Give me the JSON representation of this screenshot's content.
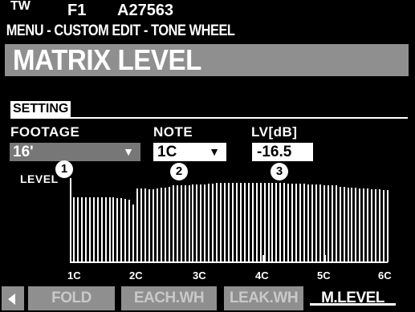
{
  "header": {
    "mode": "TW",
    "favorite": "F1",
    "patch_id": "A27563"
  },
  "breadcrumb": "MENU - CUSTOM EDIT - TONE WHEEL",
  "title": "MATRIX LEVEL",
  "setting": {
    "label": "SETTING",
    "footage": {
      "label": "FOOTAGE",
      "value": "16'"
    },
    "note": {
      "label": "NOTE",
      "value": "1C"
    },
    "level": {
      "label": "LV[dB]",
      "value": "-16.5"
    }
  },
  "badges": [
    "1",
    "2",
    "3"
  ],
  "graph": {
    "level_label": "LEVEL",
    "axis_ticks": [
      "1C",
      "2C",
      "3C",
      "4C",
      "5C",
      "6C"
    ],
    "bar_levels": [
      0.76,
      0.76,
      0.76,
      0.76,
      0.76,
      0.76,
      0.76,
      0.76,
      0.76,
      0.76,
      0.76,
      0.75,
      0.75,
      0.74,
      0.73,
      0.68,
      0.87,
      0.87,
      0.87,
      0.86,
      0.86,
      0.87,
      0.88,
      0.88,
      0.89,
      0.9,
      0.9,
      0.9,
      0.9,
      0.9,
      0.91,
      0.91,
      0.91,
      0.91,
      0.92,
      0.92,
      0.93,
      0.93,
      0.93,
      0.93,
      0.93,
      0.93,
      0.93,
      0.93,
      0.93,
      0.93,
      0.93,
      0.93,
      0.93,
      0.93,
      0.93,
      0.93,
      0.93,
      0.93,
      0.92,
      0.92,
      0.92,
      0.92,
      0.92,
      0.91,
      0.91,
      0.91,
      0.91,
      0.9,
      0.9,
      0.9,
      0.9,
      0.89,
      0.89,
      0.88,
      0.88,
      0.88,
      0.87,
      0.87,
      0.87,
      0.86,
      0.86,
      0.86,
      0.85,
      0.85
    ]
  },
  "tabs": {
    "fold": "FOLD",
    "each_wh": "EACH.WH",
    "leak_wh": "LEAK.WH",
    "m_level": "M.LEVEL"
  },
  "colors": {
    "background": "#000000",
    "accent_gray": "#8f8f8f",
    "foreground": "#ffffff"
  },
  "icons": {
    "back": "triangle-left-icon",
    "dropdown": "triangle-down-icon"
  }
}
